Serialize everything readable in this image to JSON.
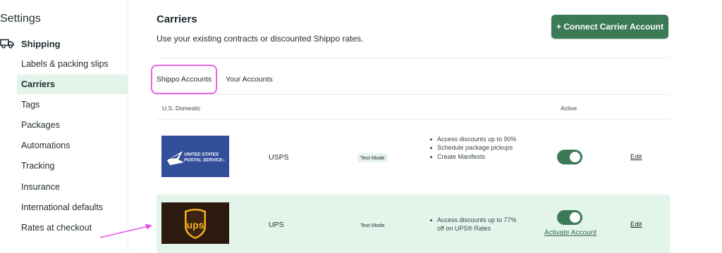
{
  "sidebar": {
    "title": "Settings",
    "section": {
      "label": "Shipping",
      "icon": "truck-icon"
    },
    "items": [
      {
        "label": "Labels & packing slips"
      },
      {
        "label": "Carriers"
      },
      {
        "label": "Tags"
      },
      {
        "label": "Packages"
      },
      {
        "label": "Automations"
      },
      {
        "label": "Tracking"
      },
      {
        "label": "Insurance"
      },
      {
        "label": "International defaults"
      },
      {
        "label": "Rates at checkout"
      }
    ],
    "active_item": "Carriers"
  },
  "main": {
    "title": "Carriers",
    "subtitle": "Use your existing contracts or discounted Shippo rates.",
    "connect_button": "+ Connect Carrier Account",
    "tabs": [
      {
        "label": "Shippo Accounts"
      },
      {
        "label": "Your Accounts"
      }
    ],
    "selected_tab": "Shippo Accounts",
    "columns": {
      "domestic": "U.S. Domestic",
      "active": "Active"
    },
    "carriers": [
      {
        "name": "USPS",
        "logo_text": [
          "UNITED STATES",
          "POSTAL SERVICE"
        ],
        "badge": "Test Mode",
        "features": [
          "Access discounts up to 90%",
          "Schedule package pickups",
          "Create Manifests"
        ],
        "active": true,
        "edit": "Edit"
      },
      {
        "name": "UPS",
        "logo_text": "ups",
        "badge": "Test Mode",
        "features": [
          "Access discounts up to 77% off on UPS® Rates"
        ],
        "active": true,
        "activate_link": "Activate Account",
        "edit": "Edit"
      }
    ]
  },
  "colors": {
    "accent": "#3c7a55",
    "active_bg": "#e3f4ea",
    "highlight": "#e566e0",
    "arrow": "#e84fe8",
    "usps_blue": "#334e9a",
    "ups_brown": "#2c1a0f",
    "ups_gold": "#f5b01a"
  }
}
